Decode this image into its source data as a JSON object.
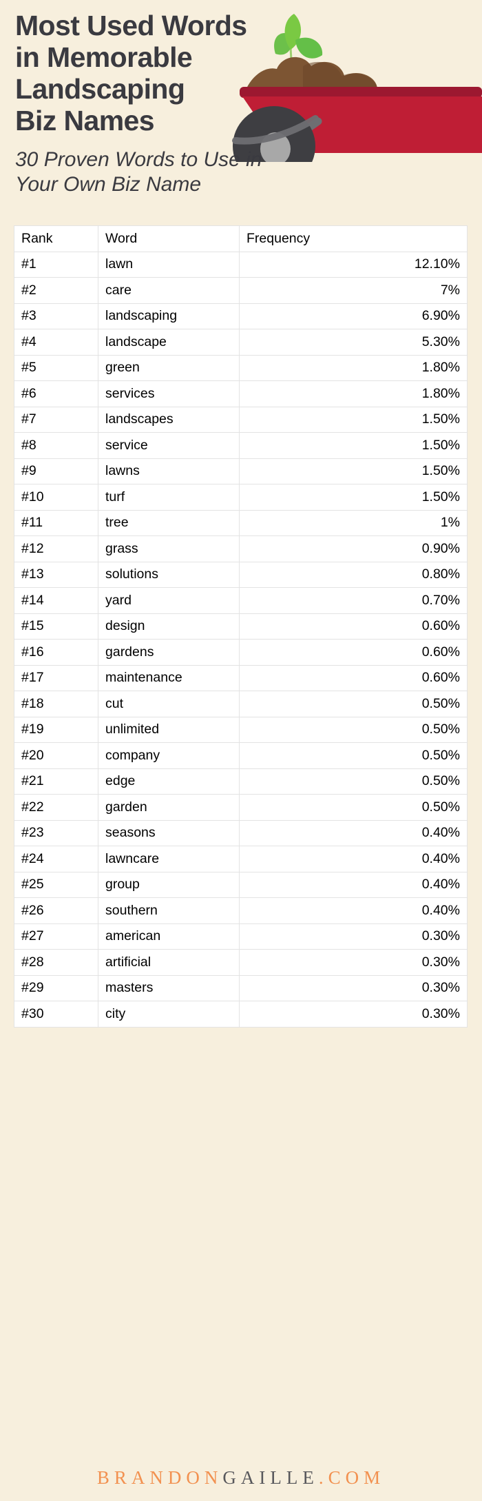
{
  "header": {
    "title": "Most Used Words\nin Memorable\nLandscaping\nBiz Names",
    "subtitle": "30 Proven Words to Use in\nYour Own Biz Name",
    "illustration_name": "wheelbarrow-with-soil-and-seedling"
  },
  "colors": {
    "background": "#f7efdd",
    "title_text": "#3a3a40",
    "table_background": "#ffffff",
    "table_border": "#e3e3e3",
    "brand_orange": "#f29150",
    "brand_gray": "#58585c",
    "wheelbarrow_red": "#bf1e35",
    "wheelbarrow_red_dark": "#9c1830",
    "soil_brown": "#7d5533",
    "soil_brown_dark": "#6b4628",
    "leaf_green_light": "#7ac943",
    "leaf_green_dark": "#4eb847",
    "wheel_dark": "#3e3e42",
    "wheel_hub": "#a8a8a8",
    "handle_gray": "#6e6e72"
  },
  "table": {
    "headers": [
      "Rank",
      "Word",
      "Frequency"
    ],
    "rows": [
      {
        "rank": "#1",
        "word": "lawn",
        "frequency": "12.10%"
      },
      {
        "rank": "#2",
        "word": "care",
        "frequency": "7%"
      },
      {
        "rank": "#3",
        "word": "landscaping",
        "frequency": "6.90%"
      },
      {
        "rank": "#4",
        "word": "landscape",
        "frequency": "5.30%"
      },
      {
        "rank": "#5",
        "word": "green",
        "frequency": "1.80%"
      },
      {
        "rank": "#6",
        "word": "services",
        "frequency": "1.80%"
      },
      {
        "rank": "#7",
        "word": "landscapes",
        "frequency": "1.50%"
      },
      {
        "rank": "#8",
        "word": "service",
        "frequency": "1.50%"
      },
      {
        "rank": "#9",
        "word": "lawns",
        "frequency": "1.50%"
      },
      {
        "rank": "#10",
        "word": "turf",
        "frequency": "1.50%"
      },
      {
        "rank": "#11",
        "word": "tree",
        "frequency": "1%"
      },
      {
        "rank": "#12",
        "word": "grass",
        "frequency": "0.90%"
      },
      {
        "rank": "#13",
        "word": "solutions",
        "frequency": "0.80%"
      },
      {
        "rank": "#14",
        "word": "yard",
        "frequency": "0.70%"
      },
      {
        "rank": "#15",
        "word": "design",
        "frequency": "0.60%"
      },
      {
        "rank": "#16",
        "word": "gardens",
        "frequency": "0.60%"
      },
      {
        "rank": "#17",
        "word": "maintenance",
        "frequency": "0.60%"
      },
      {
        "rank": "#18",
        "word": "cut",
        "frequency": "0.50%"
      },
      {
        "rank": "#19",
        "word": "unlimited",
        "frequency": "0.50%"
      },
      {
        "rank": "#20",
        "word": "company",
        "frequency": "0.50%"
      },
      {
        "rank": "#21",
        "word": "edge",
        "frequency": "0.50%"
      },
      {
        "rank": "#22",
        "word": "garden",
        "frequency": "0.50%"
      },
      {
        "rank": "#23",
        "word": "seasons",
        "frequency": "0.40%"
      },
      {
        "rank": "#24",
        "word": "lawncare",
        "frequency": "0.40%"
      },
      {
        "rank": "#25",
        "word": "group",
        "frequency": "0.40%"
      },
      {
        "rank": "#26",
        "word": "southern",
        "frequency": "0.40%"
      },
      {
        "rank": "#27",
        "word": "american",
        "frequency": "0.30%"
      },
      {
        "rank": "#28",
        "word": "artificial",
        "frequency": "0.30%"
      },
      {
        "rank": "#29",
        "word": "masters",
        "frequency": "0.30%"
      },
      {
        "rank": "#30",
        "word": "city",
        "frequency": "0.30%"
      }
    ]
  },
  "footer": {
    "brand_part1": "BRANDON",
    "brand_part2": "GAILLE",
    "brand_part3": ".COM"
  },
  "chart_data": {
    "type": "table",
    "title": "Most Used Words in Memorable Landscaping Biz Names",
    "subtitle": "30 Proven Words to Use in Your Own Biz Name",
    "columns": [
      "Rank",
      "Word",
      "Frequency"
    ],
    "xlabel": "Word",
    "ylabel": "Frequency",
    "categories": [
      "lawn",
      "care",
      "landscaping",
      "landscape",
      "green",
      "services",
      "landscapes",
      "service",
      "lawns",
      "turf",
      "tree",
      "grass",
      "solutions",
      "yard",
      "design",
      "gardens",
      "maintenance",
      "cut",
      "unlimited",
      "company",
      "edge",
      "garden",
      "seasons",
      "lawncare",
      "group",
      "southern",
      "american",
      "artificial",
      "masters",
      "city"
    ],
    "values": [
      12.1,
      7.0,
      6.9,
      5.3,
      1.8,
      1.8,
      1.5,
      1.5,
      1.5,
      1.5,
      1.0,
      0.9,
      0.8,
      0.7,
      0.6,
      0.6,
      0.6,
      0.5,
      0.5,
      0.5,
      0.5,
      0.5,
      0.4,
      0.4,
      0.4,
      0.4,
      0.3,
      0.3,
      0.3,
      0.3
    ],
    "value_labels": [
      "12.10%",
      "7%",
      "6.90%",
      "5.30%",
      "1.80%",
      "1.80%",
      "1.50%",
      "1.50%",
      "1.50%",
      "1.50%",
      "1%",
      "0.90%",
      "0.80%",
      "0.70%",
      "0.60%",
      "0.60%",
      "0.60%",
      "0.50%",
      "0.50%",
      "0.50%",
      "0.50%",
      "0.50%",
      "0.40%",
      "0.40%",
      "0.40%",
      "0.40%",
      "0.30%",
      "0.30%",
      "0.30%",
      "0.30%"
    ],
    "units": "percent",
    "grid": true,
    "legend": "none"
  }
}
